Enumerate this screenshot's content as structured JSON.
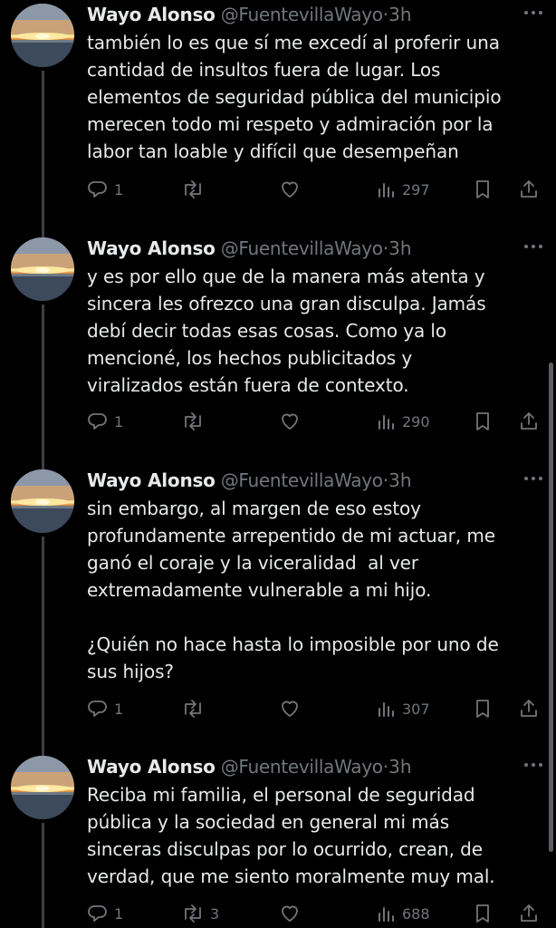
{
  "author": {
    "name": "Wayo Alonso",
    "handle": "@FuentevillaWayo",
    "separator": "·"
  },
  "tweets": [
    {
      "time": "3h",
      "text": "también lo es que sí me excedí al proferir una\ncantidad de insultos fuera de lugar. Los\nelementos de seguridad pública del municipio\nmerecen todo mi respeto y admiración por la\nlabor tan loable y difícil que desempeñan",
      "replies": "1",
      "retweets": "",
      "likes": "",
      "views": "297"
    },
    {
      "time": "3h",
      "text": "y es por ello que de la manera más atenta y\nsincera les ofrezco una gran disculpa. Jamás\ndebí decir todas esas cosas. Como ya lo\nmencioné, los hechos publicitados y\nviralizados están fuera de contexto.",
      "replies": "1",
      "retweets": "",
      "likes": "",
      "views": "290"
    },
    {
      "time": "3h",
      "text": "sin embargo, al margen de eso estoy\nprofundamente arrepentido de mi actuar, me\nganó el coraje y la viceralidad  al ver\nextremadamente vulnerable a mi hijo.\n\n¿Quién no hace hasta lo imposible por uno de\nsus hijos?",
      "replies": "1",
      "retweets": "",
      "likes": "",
      "views": "307"
    },
    {
      "time": "3h",
      "text": "Reciba mi familia, el personal de seguridad\npública y la sociedad en general mi más\nsinceras disculpas por lo ocurrido, crean, de\nverdad, que me siento moralmente muy mal.",
      "replies": "1",
      "retweets": "3",
      "likes": "",
      "views": "688"
    }
  ],
  "icons": {
    "reply": "reply-icon",
    "retweet": "retweet-icon",
    "like": "like-icon",
    "views": "views-icon",
    "bookmark": "bookmark-icon",
    "share": "share-icon",
    "more": "more-icon"
  },
  "colors": {
    "background": "#000000",
    "text": "#e7e9ea",
    "secondary": "#71767b",
    "thread_line": "#3b4046"
  }
}
